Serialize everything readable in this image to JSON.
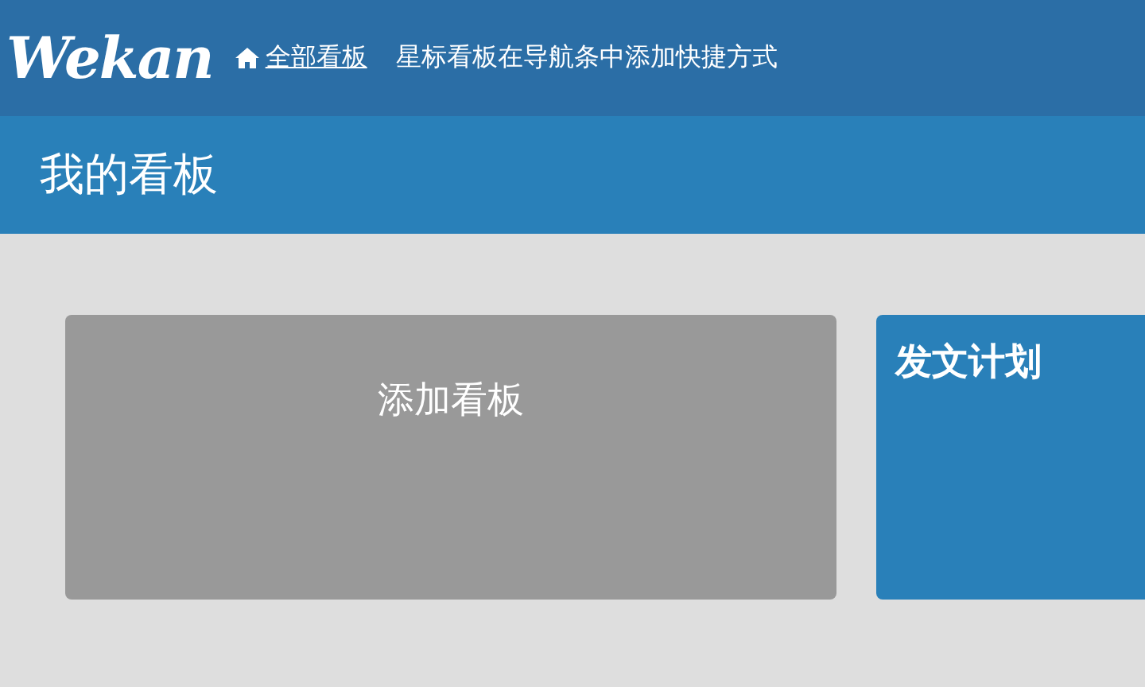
{
  "header": {
    "logo": "Wekan",
    "all_boards": "全部看板",
    "hint": "星标看板在导航条中添加快捷方式"
  },
  "page_title": "我的看板",
  "boards": [
    {
      "kind": "add",
      "title": "添加看板"
    },
    {
      "kind": "board",
      "title": "发文计划"
    }
  ]
}
